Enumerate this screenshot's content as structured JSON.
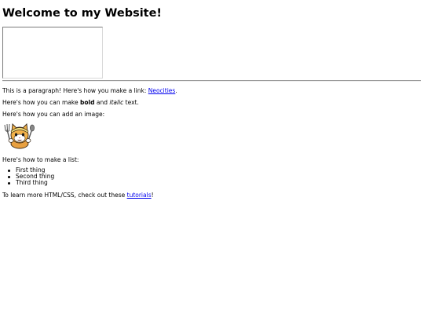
{
  "heading": "Welcome to my Website!",
  "paragraph_link": {
    "before": "This is a paragraph! Here's how you make a link: ",
    "link_text": "Neocities",
    "after": "."
  },
  "paragraph_bold": {
    "before": "Here's how you can make ",
    "bold": "bold",
    "middle": " and ",
    "italic": "italic",
    "after": " text."
  },
  "paragraph_image": "Here's how you can add an image:",
  "image": {
    "icon": "neocities-cat-mascot-icon"
  },
  "paragraph_list": "Here's how to make a list:",
  "list_items": [
    "First thing",
    "Second thing",
    "Third thing"
  ],
  "paragraph_learn": {
    "before": "To learn more HTML/CSS, check out these ",
    "link_text": "tutorials",
    "after": "!"
  },
  "colors": {
    "link": "#0000ee",
    "text": "#000000",
    "background": "#ffffff"
  }
}
